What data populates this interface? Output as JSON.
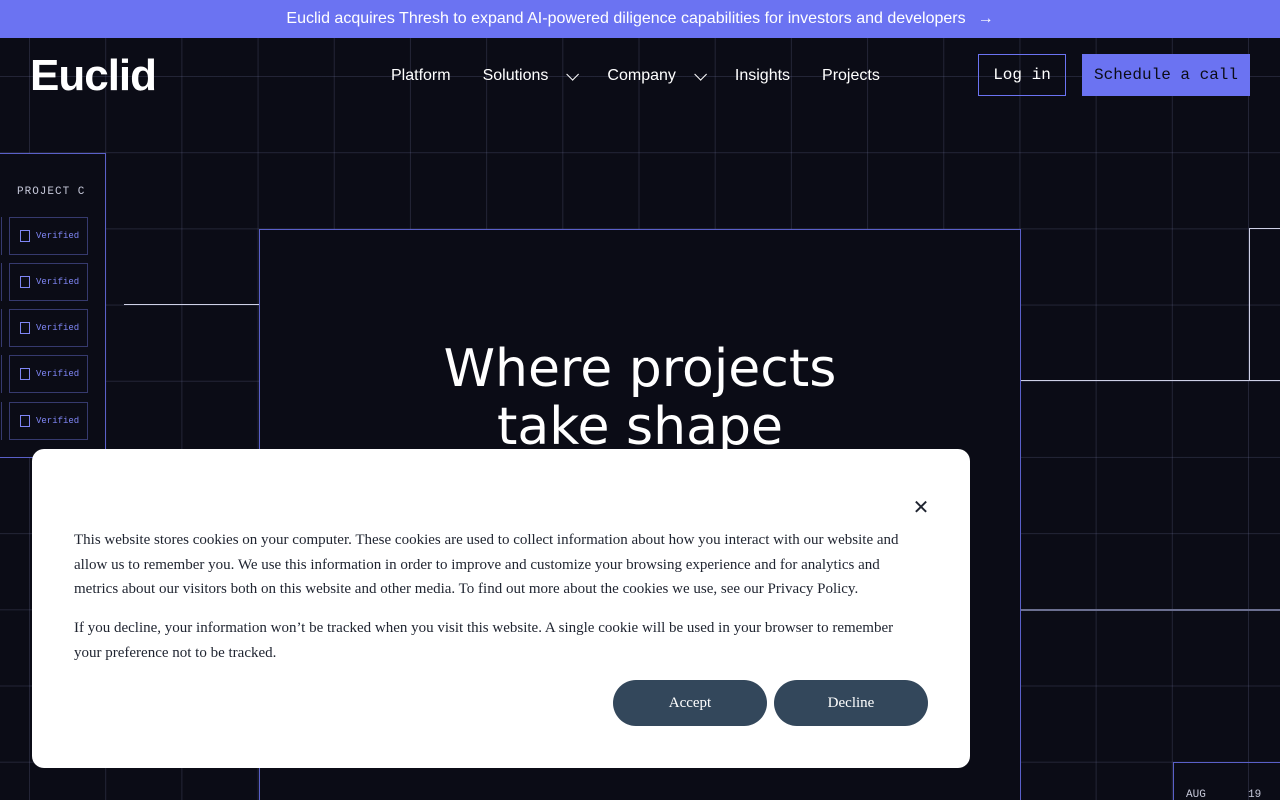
{
  "announcement": {
    "text": "Euclid acquires Thresh to expand AI-powered diligence capabilities for investors and developers",
    "arrow": "→"
  },
  "header": {
    "logo": "Euclid",
    "nav": [
      {
        "label": "Platform",
        "has_dropdown": false
      },
      {
        "label": "Solutions",
        "has_dropdown": true
      },
      {
        "label": "Company",
        "has_dropdown": true
      },
      {
        "label": "Insights",
        "has_dropdown": false
      },
      {
        "label": "Projects",
        "has_dropdown": false
      }
    ],
    "login_label": "Log in",
    "schedule_label": "Schedule a call"
  },
  "hero": {
    "title_line1": "Where projects",
    "title_line2": "take shape"
  },
  "project_panel": {
    "label": "PROJECT C",
    "items": [
      "Verified",
      "Verified",
      "Verified",
      "Verified",
      "Verified"
    ]
  },
  "date_card": {
    "month": "AUG",
    "day": "19"
  },
  "cookie_banner": {
    "paragraph1": "This website stores cookies on your computer. These cookies are used to collect information about how you interact with our website and allow us to remember you. We use this information in order to improve and customize your browsing experience and for analytics and metrics about our visitors both on this website and other media. To find out more about the cookies we use, see our Privacy Policy.",
    "paragraph2": "If you decline, your information won’t be tracked when you visit this website. A single cookie will be used in your browser to remember your preference not to be tracked.",
    "accept_label": "Accept",
    "decline_label": "Decline",
    "close_symbol": "✕"
  },
  "colors": {
    "accent": "#6b73f2",
    "background": "#0b0c16",
    "button_dark": "#33475b"
  }
}
